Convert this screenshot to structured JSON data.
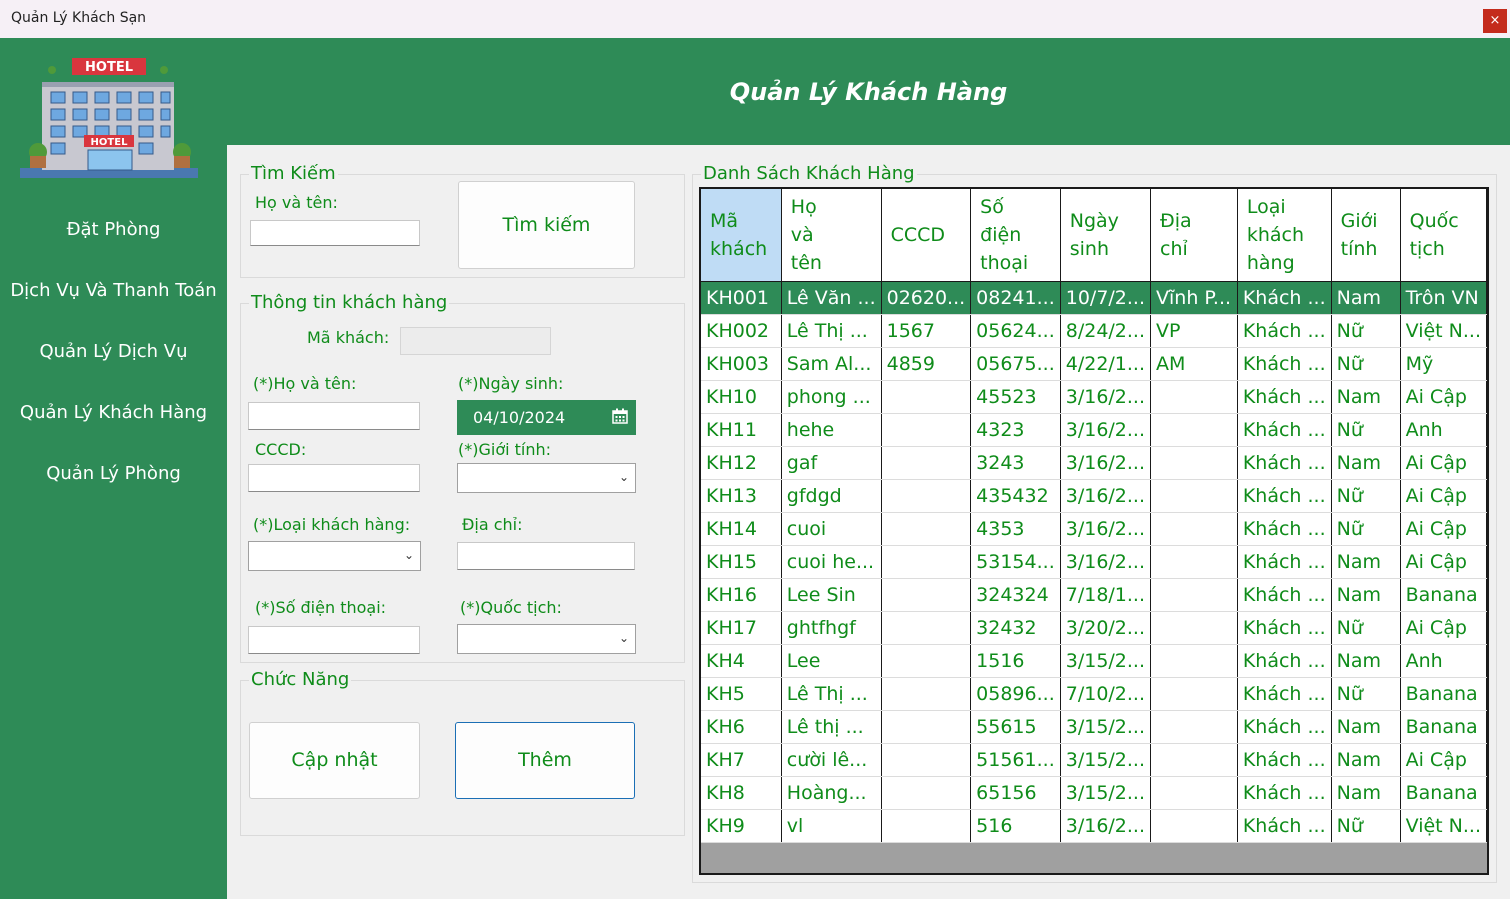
{
  "window": {
    "title": "Quản Lý Khách Sạn",
    "close": "×"
  },
  "header": {
    "title": "Quản Lý Khách Hàng"
  },
  "logo": {
    "sign1": "HOTEL",
    "sign2": "HOTEL"
  },
  "sidebar": {
    "items": [
      {
        "label": "Đặt Phòng"
      },
      {
        "label": "Dịch Vụ Và Thanh Toán"
      },
      {
        "label": "Quản Lý Dịch Vụ"
      },
      {
        "label": "Quản Lý Khách Hàng"
      },
      {
        "label": "Quản Lý Phòng"
      }
    ]
  },
  "search": {
    "legend": "Tìm Kiếm",
    "name_label": "Họ và tên:",
    "name_value": "",
    "button": "Tìm kiếm"
  },
  "info": {
    "legend": "Thông tin khách hàng",
    "id_label": "Mã khách:",
    "id_value": "",
    "name_label": "(*)Họ và tên:",
    "name_value": "",
    "dob_label": "(*)Ngày sinh:",
    "dob_value": "04/10/2024",
    "cccd_label": "CCCD:",
    "cccd_value": "",
    "gender_label": "(*)Giới tính:",
    "gender_value": "",
    "type_label": "(*)Loại khách hàng:",
    "type_value": "",
    "address_label": "Địa chỉ:",
    "address_value": "",
    "phone_label": "(*)Số điện thoại:",
    "phone_value": "",
    "nation_label": "(*)Quốc tịch:",
    "nation_value": ""
  },
  "functions": {
    "legend": "Chức Năng",
    "update": "Cập nhật",
    "add": "Thêm"
  },
  "list": {
    "legend": "Danh Sách Khách Hàng",
    "columns": [
      [
        "Mã",
        "khách"
      ],
      [
        "Họ",
        "và",
        "tên"
      ],
      [
        "CCCD"
      ],
      [
        "Số",
        "điện",
        "thoại"
      ],
      [
        "Ngày",
        "sinh"
      ],
      [
        "Địa",
        "chỉ"
      ],
      [
        "Loại",
        "khách",
        "hàng"
      ],
      [
        "Giới",
        "tính"
      ],
      [
        "Quốc",
        "tịch"
      ]
    ],
    "rows": [
      [
        "KH001",
        "Lê Văn ...",
        "02620...",
        "08241...",
        "10/7/2...",
        "Vĩnh P...",
        "Khách ...",
        "Nam",
        "Trôn VN"
      ],
      [
        "KH002",
        "Lê Thị ...",
        "1567",
        "05624...",
        "8/24/2...",
        "VP",
        "Khách ...",
        "Nữ",
        "Việt N..."
      ],
      [
        "KH003",
        "Sam Al...",
        "4859",
        "05675...",
        "4/22/1...",
        "AM",
        "Khách ...",
        "Nữ",
        "Mỹ"
      ],
      [
        "KH10",
        "phong ...",
        "",
        "45523",
        "3/16/2...",
        "",
        "Khách ...",
        "Nam",
        "Ai Cập"
      ],
      [
        "KH11",
        "hehe",
        "",
        "4323",
        "3/16/2...",
        "",
        "Khách ...",
        "Nữ",
        "Anh"
      ],
      [
        "KH12",
        "gaf",
        "",
        "3243",
        "3/16/2...",
        "",
        "Khách ...",
        "Nam",
        "Ai Cập"
      ],
      [
        "KH13",
        "gfdgd",
        "",
        "435432",
        "3/16/2...",
        "",
        "Khách ...",
        "Nữ",
        "Ai Cập"
      ],
      [
        "KH14",
        "cuoi",
        "",
        "4353",
        "3/16/2...",
        "",
        "Khách ...",
        "Nữ",
        "Ai Cập"
      ],
      [
        "KH15",
        "cuoi he...",
        "",
        "53154...",
        "3/16/2...",
        "",
        "Khách ...",
        "Nam",
        "Ai Cập"
      ],
      [
        "KH16",
        "Lee Sin",
        "",
        "324324",
        "7/18/1...",
        "",
        "Khách ...",
        "Nam",
        "Banana"
      ],
      [
        "KH17",
        "ghtfhgf",
        "",
        "32432",
        "3/20/2...",
        "",
        "Khách ...",
        "Nữ",
        "Ai Cập"
      ],
      [
        "KH4",
        "Lee",
        "",
        "1516",
        "3/15/2...",
        "",
        "Khách ...",
        "Nam",
        "Anh"
      ],
      [
        "KH5",
        "Lê Thị ...",
        "",
        "05896...",
        "7/10/2...",
        "",
        "Khách ...",
        "Nữ",
        "Banana"
      ],
      [
        "KH6",
        "Lê thị ...",
        "",
        "55615",
        "3/15/2...",
        "",
        "Khách ...",
        "Nam",
        "Banana"
      ],
      [
        "KH7",
        "cười lê...",
        "",
        "51561...",
        "3/15/2...",
        "",
        "Khách ...",
        "Nam",
        "Ai Cập"
      ],
      [
        "KH8",
        "Hoàng...",
        "",
        "65156",
        "3/15/2...",
        "",
        "Khách ...",
        "Nam",
        "Banana"
      ],
      [
        "KH9",
        "vl",
        "",
        "516",
        "3/16/2...",
        "",
        "Khách ...",
        "Nữ",
        "Việt N..."
      ]
    ]
  }
}
